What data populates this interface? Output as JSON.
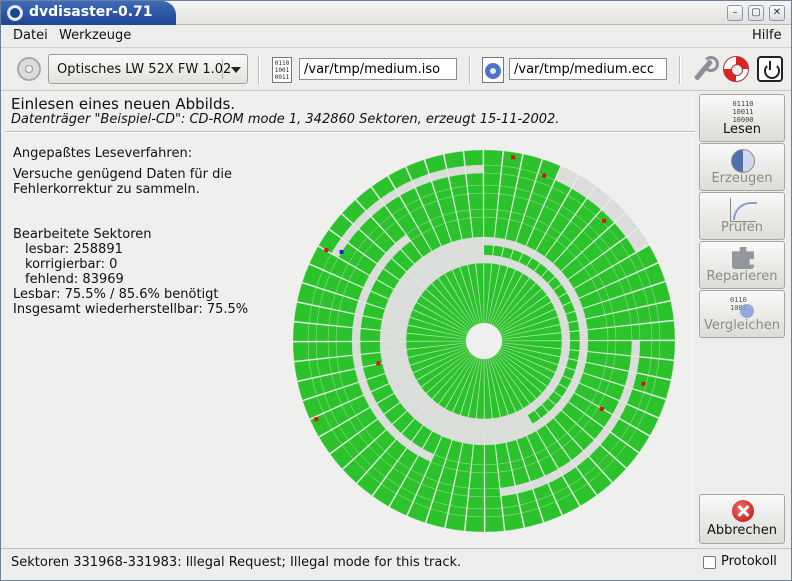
{
  "window": {
    "title": "dvdisaster-0.71",
    "minimize_glyph": "–",
    "maximize_glyph": "▢",
    "close_glyph": "✕"
  },
  "menubar": {
    "items": [
      "Datei",
      "Werkzeuge"
    ],
    "help": "Hilfe"
  },
  "toolbar": {
    "drive": "Optisches LW 52X FW 1.02",
    "iso_icon_text": "0110\n1001\n0011",
    "image_path": "/var/tmp/medium.iso",
    "ecc_path": "/var/tmp/medium.ecc",
    "icons": [
      "cd-icon",
      "binary-file-icon",
      "ecc-file-icon",
      "wrench-icon",
      "lifebuoy-icon",
      "power-icon"
    ]
  },
  "main": {
    "heading": "Einlesen eines neuen Abbilds.",
    "subheading": "Datenträger \"Beispiel-CD\": CD-ROM mode 1, 342860 Sektoren, erzeugt 15-11-2002.",
    "method_label": "Angepaßtes Leseverfahren:",
    "method_desc_1": "Versuche genügend Daten für die",
    "method_desc_2": "Fehlerkorrektur zu sammeln.",
    "stats_title": "Bearbeitete Sektoren",
    "readable": "lesbar: 258891",
    "correctable": "korrigierbar: 0",
    "missing": "fehlend: 83969",
    "readable_pct": "Lesbar: 75.5% / 85.6% benötigt",
    "recoverable": "Insgesamt wiederherstellbar: 75.5%"
  },
  "disc": {
    "colors": {
      "read": "#2cc22c",
      "unread": "#dcdcdc",
      "error": "#e01010",
      "current": "#1030c8"
    },
    "readable_fraction": 0.755
  },
  "side_buttons": [
    {
      "label": "Lesen",
      "icon_text": "01110\n10011\n10000"
    },
    {
      "label": "Erzeugen"
    },
    {
      "label": "Prüfen"
    },
    {
      "label": "Reparieren"
    },
    {
      "label": "Vergleichen",
      "icon_text": "0110\n1001"
    }
  ],
  "abort_label": "Abbrechen",
  "statusbar": {
    "message": "Sektoren 331968-331983: Illegal Request; Illegal mode for this track.",
    "log_label": "Protokoll"
  }
}
